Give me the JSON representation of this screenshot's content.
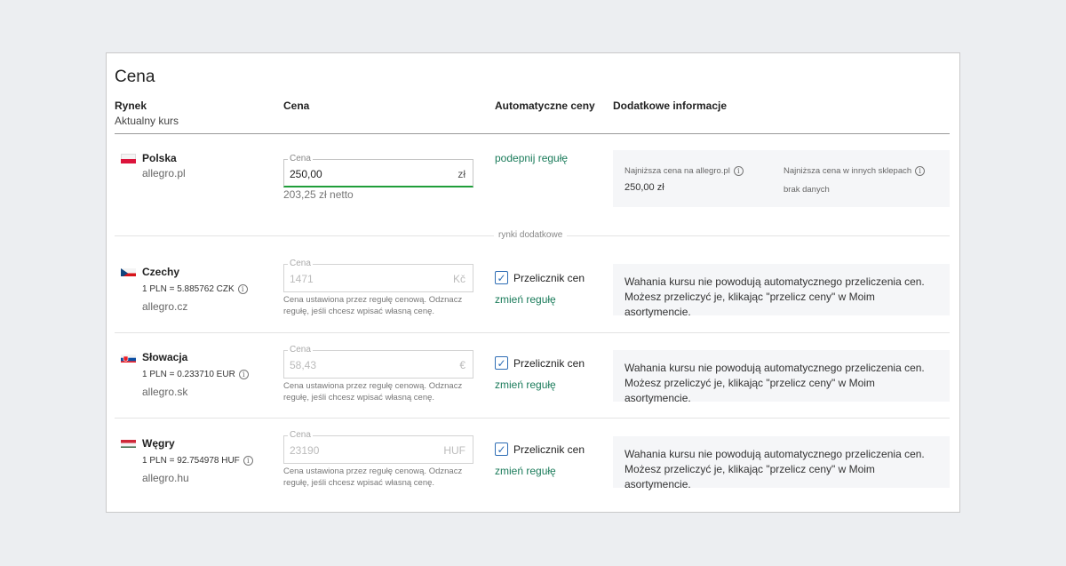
{
  "title": "Cena",
  "headers": {
    "market": "Rynek",
    "market_sub": "Aktualny kurs",
    "price": "Cena",
    "auto": "Automatyczne ceny",
    "extra": "Dodatkowe informacje"
  },
  "separator_label": "rynki dodatkowe",
  "poland": {
    "country": "Polska",
    "domain": "allegro.pl",
    "price_label": "Cena",
    "price_value": "250,00",
    "currency": "zł",
    "netto": "203,25 zł netto",
    "link": "podepnij regułę",
    "lowest_allegro_label": "Najniższa cena na allegro.pl",
    "lowest_allegro_value": "250,00 zł",
    "lowest_other_label": "Najniższa cena w innych sklepach",
    "lowest_other_value": "brak danych"
  },
  "markets": [
    {
      "country": "Czechy",
      "rate": "1 PLN = 5.885762 CZK",
      "domain": "allegro.cz",
      "price_label": "Cena",
      "price_value": "1471",
      "currency": "Kč",
      "note": "Cena ustawiona przez regułę cenową. Odznacz regułę, jeśli chcesz wpisać własną cenę.",
      "checkbox_label": "Przelicznik cen",
      "link": "zmień regułę",
      "info": "Wahania kursu nie powodują automatycznego przeliczenia cen. Możesz przeliczyć je, klikając \"przelicz ceny\" w Moim asortymencie."
    },
    {
      "country": "Słowacja",
      "rate": "1 PLN = 0.233710 EUR",
      "domain": "allegro.sk",
      "price_label": "Cena",
      "price_value": "58,43",
      "currency": "€",
      "note": "Cena ustawiona przez regułę cenową. Odznacz regułę, jeśli chcesz wpisać własną cenę.",
      "checkbox_label": "Przelicznik cen",
      "link": "zmień regułę",
      "info": "Wahania kursu nie powodują automatycznego przeliczenia cen. Możesz przeliczyć je, klikając \"przelicz ceny\" w Moim asortymencie."
    },
    {
      "country": "Węgry",
      "rate": "1 PLN = 92.754978 HUF",
      "domain": "allegro.hu",
      "price_label": "Cena",
      "price_value": "23190",
      "currency": "HUF",
      "note": "Cena ustawiona przez regułę cenową. Odznacz regułę, jeśli chcesz wpisać własną cenę.",
      "checkbox_label": "Przelicznik cen",
      "link": "zmień regułę",
      "info": "Wahania kursu nie powodują automatycznego przeliczenia cen. Możesz przeliczyć je, klikając \"przelicz ceny\" w Moim asortymencie."
    }
  ],
  "colors": {
    "accent_green": "#1f9e3a",
    "link_green": "#1a7b5a",
    "checkbox_blue": "#2e6db5"
  }
}
